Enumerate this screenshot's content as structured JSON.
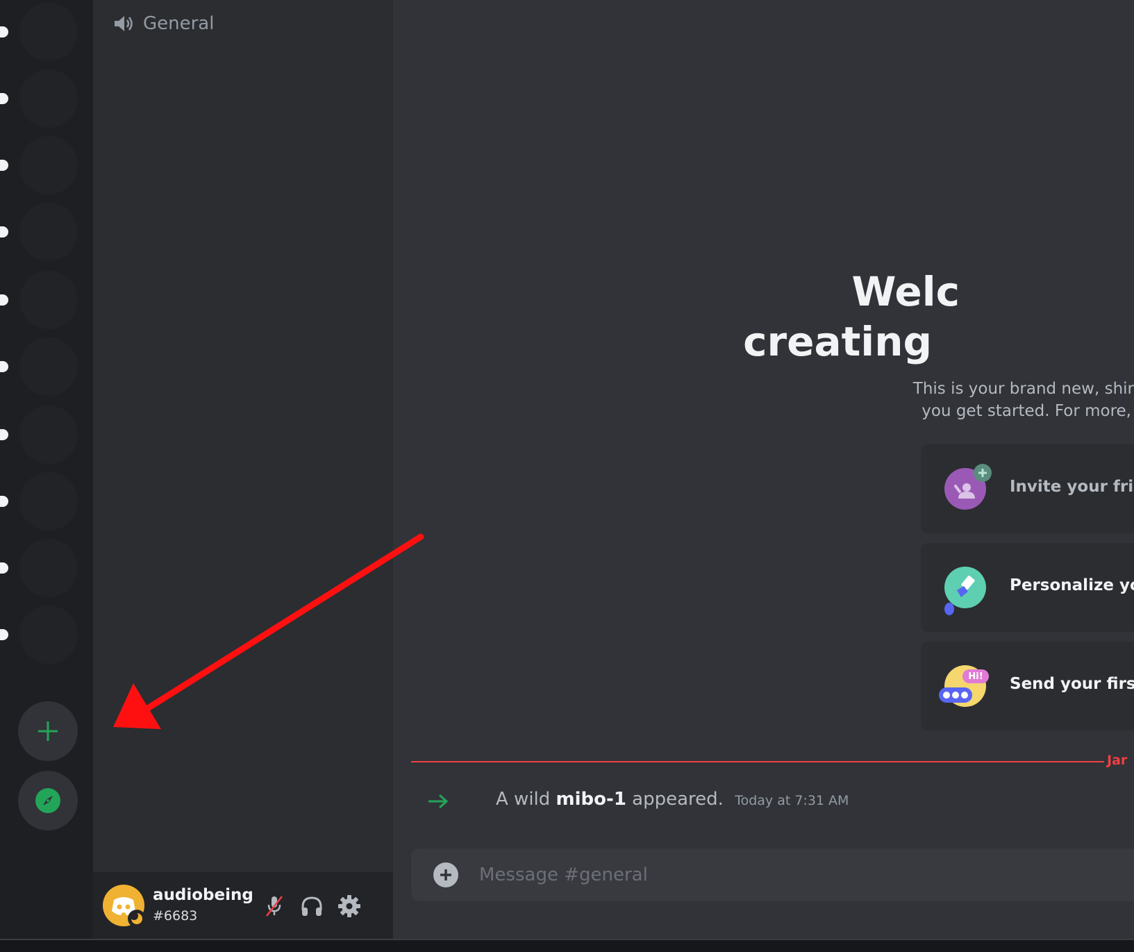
{
  "channel": {
    "name": "General"
  },
  "welcome": {
    "title_line1": "Welc",
    "title_line2": "creating",
    "desc_line1": "This is your brand new, shir",
    "desc_line2": "you get started. For more,"
  },
  "cards": [
    {
      "label": "Invite your frienc",
      "icon": "invite-friends-icon",
      "color": "#9b59b6"
    },
    {
      "label": "Personalize your",
      "icon": "paintbrush-icon",
      "color": "#5ecfb1"
    },
    {
      "label": "Send your first m",
      "icon": "hi-chat-icon",
      "color": "#f5d76e"
    }
  ],
  "divider": {
    "date": "Jar"
  },
  "system_message": {
    "prefix": "A wild",
    "username": "mibo-1",
    "suffix": "appeared.",
    "timestamp": "Today at 7:31 AM"
  },
  "composer": {
    "placeholder": "Message #general"
  },
  "user": {
    "name": "audiobeing",
    "tag": "#6683"
  },
  "colors": {
    "accent_green": "#23a559",
    "danger_red": "#f23f43",
    "annotation_red": "#ff0000"
  },
  "icons": [
    "speaker-icon",
    "add-server-icon",
    "explore-compass-icon",
    "mute-mic-icon",
    "headphones-icon",
    "settings-gear-icon",
    "plus-circle-icon",
    "join-arrow-icon"
  ]
}
